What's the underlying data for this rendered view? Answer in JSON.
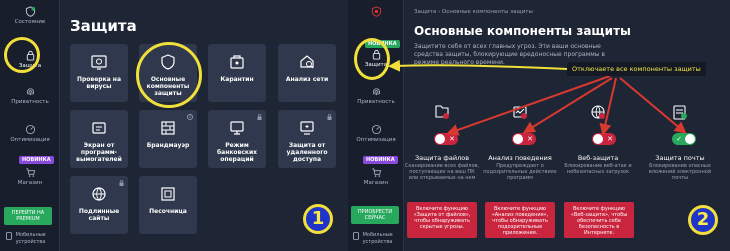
{
  "colors": {
    "background": "#1e2535",
    "sidebar": "#181e2c",
    "tile": "#2f384c",
    "highlight": "#f1df3a",
    "accent_green": "#27a85c",
    "alert_red": "#c9253f",
    "badge_purple": "#8a4bdc",
    "number_circle": "#1f34c9"
  },
  "panel1": {
    "sidebar": {
      "status_label": "Состояние",
      "protection_label": "Защита",
      "privacy_label": "Приватность",
      "optimization_label": "Оптимизация",
      "new_badge": "НОВИНКА",
      "store_label": "Магазин",
      "premium_button": "ПЕРЕЙТИ НА PREMIUM",
      "mobile_label": "Мобильные устройства"
    },
    "title": "Защита",
    "tiles": [
      {
        "label": "Проверка на вирусы",
        "icon": "virus-scan-icon"
      },
      {
        "label": "Основные компоненты защиты",
        "icon": "shield-icon"
      },
      {
        "label": "Карантин",
        "icon": "quarantine-icon"
      },
      {
        "label": "Анализ сети",
        "icon": "network-icon"
      },
      {
        "label": "Экран от программ-вымогателей",
        "icon": "ransomware-icon"
      },
      {
        "label": "Брандмауэр",
        "icon": "firewall-icon"
      },
      {
        "label": "Режим банковских операций",
        "icon": "bank-icon"
      },
      {
        "label": "Защита от удаленного доступа",
        "icon": "remote-access-icon"
      },
      {
        "label": "Подлинные сайты",
        "icon": "real-site-icon"
      },
      {
        "label": "Песочница",
        "icon": "sandbox-icon"
      }
    ],
    "step_number": "1"
  },
  "panel2": {
    "sidebar": {
      "new_badge": "НОВИНКА",
      "protection_label": "Защита",
      "privacy_label": "Приватность",
      "optimization_label": "Оптимизация",
      "new_badge2": "НОВИНКА",
      "store_label": "Магазин",
      "premium_button": "ПРИОБРЕСТИ СЕЙЧАС",
      "mobile_label": "Мобильные устройства"
    },
    "breadcrumb": "Защита › Основные компоненты защиты",
    "title": "Основные компоненты защиты",
    "description": "Защитите себя от всех главных угроз. Эти ваши основные средства защиты, блокирующие вредоносные программы в режиме реального времени.",
    "callout": "Отключаете все компоненты защиты",
    "components": [
      {
        "title": "Защита файлов",
        "desc": "Сканирование всех файлов, поступающих на ваш ПК или открываемых на нем",
        "state": "off",
        "icon": "file-shield-icon",
        "warning": "Включите функцию «Защита от файлов», чтобы обнаруживать скрытые угрозы."
      },
      {
        "title": "Анализ поведения",
        "desc": "Предупреждает о подозрительных действиях программ",
        "state": "off",
        "icon": "behavior-icon",
        "warning": "Включите функцию «Анализ поведения», чтобы обнаруживать подозрительные приложения."
      },
      {
        "title": "Веб-защита",
        "desc": "Блокирование веб-атак и небезопасных загрузок",
        "state": "off",
        "icon": "web-shield-icon",
        "warning": "Включите функцию «Веб-защита», чтобы обеспечить себе безопасность в Интернете."
      },
      {
        "title": "Защита почты",
        "desc": "Блокирование опасных вложений электронной почты",
        "state": "on",
        "icon": "mail-shield-icon"
      }
    ],
    "step_number": "2"
  }
}
